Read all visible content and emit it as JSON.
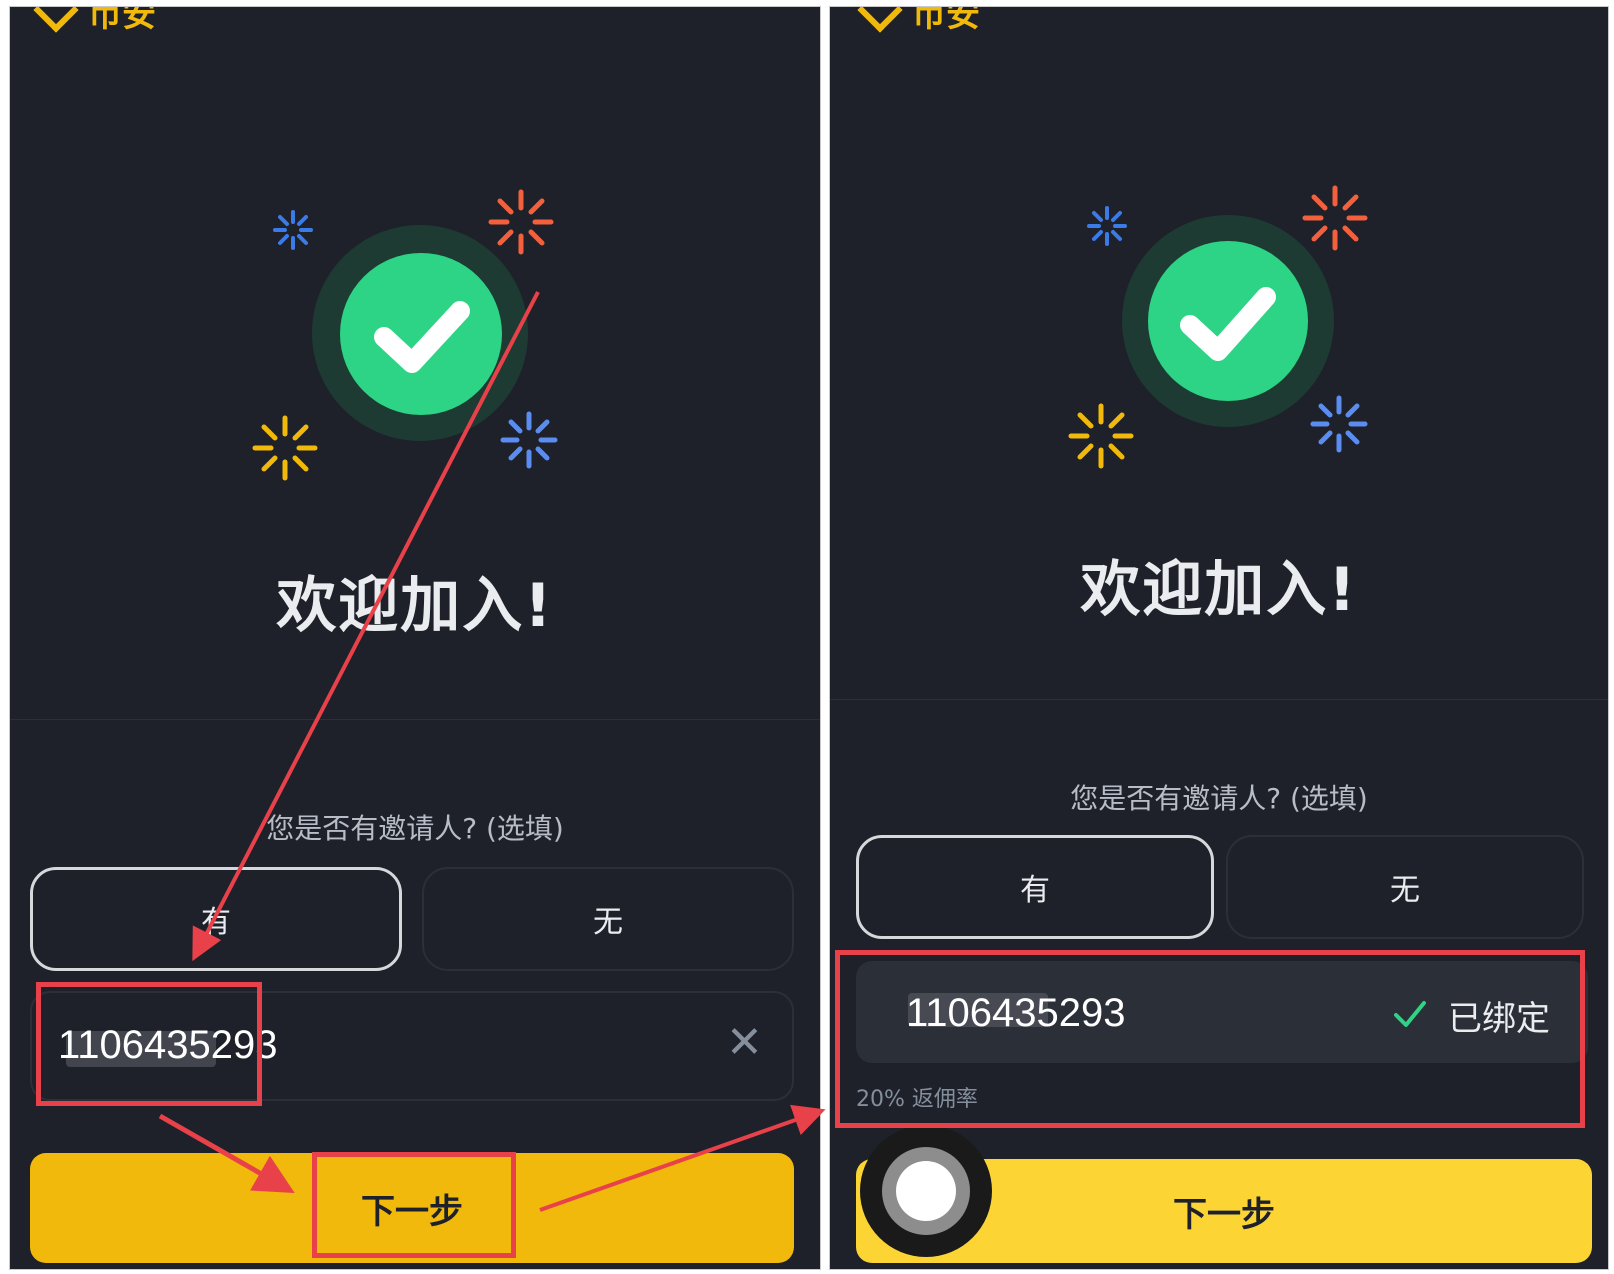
{
  "brand": {
    "logo_text": "币安"
  },
  "left": {
    "welcome": "欢迎加入!",
    "inviter_question": "您是否有邀请人? (选填)",
    "option_yes": "有",
    "option_no": "无",
    "referral_value": "1106435293",
    "next_label": "下一步"
  },
  "right": {
    "welcome": "欢迎加入!",
    "inviter_question": "您是否有邀请人? (选填)",
    "option_yes": "有",
    "option_no": "无",
    "referral_value": "1106435293",
    "bound_label": "已绑定",
    "commission_rate": "20% 返佣率",
    "next_label": "下一步"
  },
  "colors": {
    "background": "#1e2129",
    "accent": "#f0b90b",
    "success": "#2ed486",
    "annotation": "#e8414a"
  },
  "icons": [
    "checkmark-icon",
    "sparkle-icon",
    "close-icon",
    "check-icon",
    "touch-cursor-icon"
  ]
}
